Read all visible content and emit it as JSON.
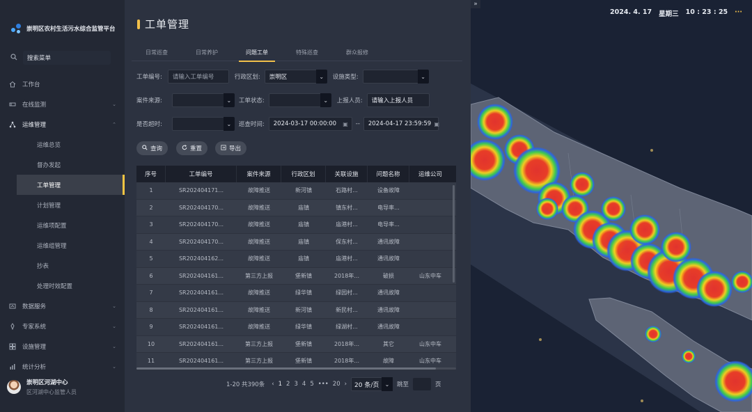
{
  "app": {
    "title": "崇明区农村生活污水综合监管平台"
  },
  "sidebar": {
    "search_label": "搜索菜单",
    "items": [
      {
        "label": "工作台",
        "icon": "home-icon"
      },
      {
        "label": "在线监测",
        "icon": "monitor-icon"
      },
      {
        "label": "运维管理",
        "icon": "network-icon"
      }
    ],
    "sub_items": [
      "运维总览",
      "督办发起",
      "工单管理",
      "计划管理",
      "运维项配置",
      "运维组管理",
      "抄表",
      "处理时效配置"
    ],
    "more_items": [
      {
        "label": "数据服务",
        "icon": "data-icon"
      },
      {
        "label": "专家系统",
        "icon": "expert-icon"
      },
      {
        "label": "设施管理",
        "icon": "grid-icon"
      },
      {
        "label": "统计分析",
        "icon": "chart-icon"
      }
    ],
    "user": {
      "name": "崇明区河湖中心",
      "role": "区河湖中心监管人员"
    }
  },
  "page": {
    "title": "工单管理",
    "tabs": [
      "日常巡查",
      "日常养护",
      "问题工单",
      "特殊巡查",
      "群众报修"
    ],
    "active_tab": 2
  },
  "filters": {
    "order_no_label": "工单编号:",
    "order_no_placeholder": "请输入工单编号",
    "district_label": "行政区划:",
    "district_value": "崇明区",
    "facility_type_label": "设施类型:",
    "case_source_label": "案件来源:",
    "order_status_label": "工单状态:",
    "reporter_label": "上报人员:",
    "reporter_placeholder": "请输入上报人员",
    "overdue_label": "是否超时:",
    "patrol_time_label": "巡查时间:",
    "start_time": "2024-03-17 00:00:00",
    "time_sep": "--",
    "end_time": "2024-04-17 23:59:59"
  },
  "actions": {
    "query": "查询",
    "reset": "重置",
    "export": "导出"
  },
  "table": {
    "columns": [
      "序号",
      "工单编号",
      "案件来源",
      "行政区划",
      "关联设施",
      "问题名称",
      "运维公司"
    ],
    "rows": [
      [
        "1",
        "SR202404171...",
        "故障推送",
        "新河镇",
        "石路村...",
        "设备故障",
        ""
      ],
      [
        "2",
        "SR202404170...",
        "故障推送",
        "庙镇",
        "镇东村...",
        "电导率...",
        ""
      ],
      [
        "3",
        "SR202404170...",
        "故障推送",
        "庙镇",
        "庙港村...",
        "电导率...",
        ""
      ],
      [
        "4",
        "SR202404170...",
        "故障推送",
        "庙镇",
        "保东村...",
        "通讯故障",
        ""
      ],
      [
        "5",
        "SR202404162...",
        "故障推送",
        "庙镇",
        "庙港村...",
        "通讯故障",
        ""
      ],
      [
        "6",
        "SR202404161...",
        "第三方上报",
        "堡新镇",
        "2018年...",
        "破损",
        "山东中车"
      ],
      [
        "7",
        "SR202404161...",
        "故障推送",
        "绿华镇",
        "绿园村...",
        "通讯故障",
        ""
      ],
      [
        "8",
        "SR202404161...",
        "故障推送",
        "新河镇",
        "新民村...",
        "通讯故障",
        ""
      ],
      [
        "9",
        "SR202404161...",
        "故障推送",
        "绿华镇",
        "绿湖村...",
        "通讯故障",
        ""
      ],
      [
        "10",
        "SR202404161...",
        "第三方上报",
        "堡新镇",
        "2018年...",
        "其它",
        "山东中车"
      ],
      [
        "11",
        "SR202404161...",
        "第三方上报",
        "堡新镇",
        "2018年...",
        "故障",
        "山东中车"
      ]
    ]
  },
  "pagination": {
    "summary": "1-20 共390条",
    "prev": "‹",
    "pages": [
      "1",
      "2",
      "3",
      "4",
      "5",
      "•••",
      "20"
    ],
    "next": "›",
    "page_size": "20 条/页",
    "jump_label": "跳至",
    "page_suffix": "页"
  },
  "map": {
    "date": "2024. 4. 17",
    "weekday": "星期三",
    "time": "10 : 23 : 25",
    "more": "···",
    "collapse": "»"
  }
}
